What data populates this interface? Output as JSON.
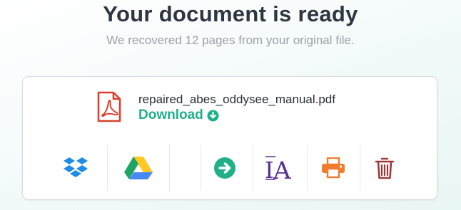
{
  "header": {
    "title": "Your document is ready",
    "subtitle": "We recovered 12 pages from your original file."
  },
  "file": {
    "name": "repaired_abes_oddysee_manual.pdf",
    "download_label": "Download"
  },
  "tools": [
    {
      "icon": "dropbox-icon",
      "color": "#1f8ce6"
    },
    {
      "icon": "google-drive-icon",
      "color": "#1fa463"
    },
    {
      "icon": "arrow-right-circle-icon",
      "color": "#1fb08a"
    },
    {
      "icon": "font-translate-icon",
      "color": "#5a2d91"
    },
    {
      "icon": "printer-icon",
      "color": "#f07c2e"
    },
    {
      "icon": "trash-icon",
      "color": "#a33a3a"
    }
  ],
  "colors": {
    "accent": "#1fb08a",
    "pdf_red": "#d9412d",
    "title": "#2f3541",
    "subtitle": "#9aa0a6"
  }
}
